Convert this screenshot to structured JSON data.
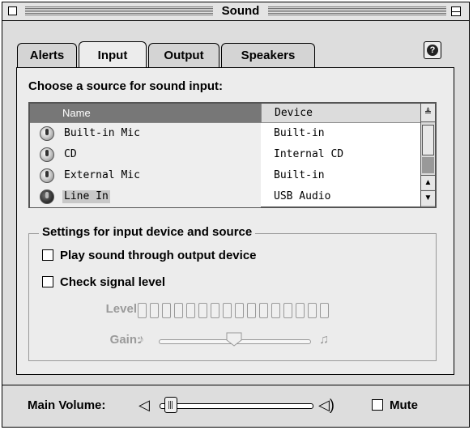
{
  "window": {
    "title": "Sound"
  },
  "tabs": [
    {
      "label": "Alerts",
      "active": false
    },
    {
      "label": "Input",
      "active": true
    },
    {
      "label": "Output",
      "active": false
    },
    {
      "label": "Speakers",
      "active": false
    }
  ],
  "help_icon": "help-icon",
  "input": {
    "heading": "Choose a source for sound input:",
    "columns": {
      "name": "Name",
      "device": "Device"
    },
    "rows": [
      {
        "name": "Built-in Mic",
        "device": "Built-in",
        "selected": false
      },
      {
        "name": "CD",
        "device": "Internal CD",
        "selected": false
      },
      {
        "name": "External Mic",
        "device": "Built-in",
        "selected": false
      },
      {
        "name": "Line In",
        "device": "USB Audio",
        "selected": true
      }
    ]
  },
  "settings": {
    "title": "Settings for input device and source",
    "play_through": {
      "label": "Play sound through output device",
      "checked": false
    },
    "check_level": {
      "label": "Check signal level",
      "checked": false
    },
    "level_label": "Level:",
    "gain_label": "Gain:",
    "level_segments": 16,
    "gain_value": 0.5
  },
  "bottom": {
    "main_volume_label": "Main Volume:",
    "volume_value": 0.03,
    "mute": {
      "label": "Mute",
      "checked": false
    }
  }
}
